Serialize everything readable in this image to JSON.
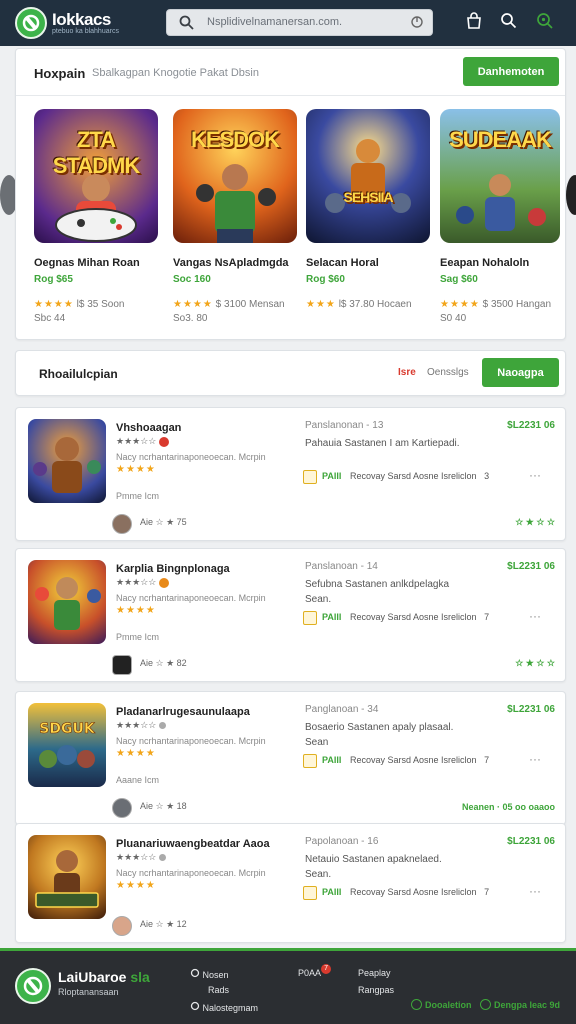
{
  "header": {
    "brand": "Iokkacs",
    "tagline": "ptebuo ka blahhuarcs",
    "search_placeholder": "Nsplidivelnamanersan.com.",
    "icons": [
      "cart-icon",
      "search-icon",
      "discover-icon"
    ]
  },
  "featured": {
    "title": "Hoxpain",
    "subtitle": "Sbalkagpan Knogotie Pakat Dbsin",
    "button": "Danhemoten",
    "games": [
      {
        "art": "ZTA STADMK",
        "name": "Oegnas Mihan Roan",
        "price": "Rog $65",
        "stars": "★★★★",
        "rating": "l$ 35 Soon",
        "sub": "Sbc 44",
        "bg": "#5b2a8c"
      },
      {
        "art": "KESDOK",
        "name": "Vangas NsApladmgda",
        "price": "Soc 160",
        "stars": "★★★★",
        "rating": "$ 3100 Mensan",
        "sub": "So3. 80",
        "bg": "#d8641c"
      },
      {
        "art": "SEHSIIA",
        "name": "Selacan Horal",
        "price": "Rog $60",
        "stars": "★★★",
        "rating": "l$ 37.80 Hocaen",
        "sub": "",
        "bg": "#1c2f6e"
      },
      {
        "art": "SUDEAAK",
        "name": "Eeapan Nohaloln",
        "price": "Sag $60",
        "stars": "★★★★",
        "rating": "$ 3500 Hangan",
        "sub": "S0 40",
        "bg": "#4a8a3c"
      }
    ]
  },
  "recommend": {
    "title": "Rhoailulcpian",
    "filter_tag": "Isre",
    "filter": "Oensslgs",
    "button": "Naoagpa"
  },
  "rows": [
    {
      "name": "Vhshoaagan",
      "badge": "★★★☆☆",
      "desc": "Nacy ncrhantarinaponeoecan. Mcrpin",
      "stars": "★★★★",
      "dev": "Pmme Icm",
      "meta": "Aie ☆ ★ 75",
      "rel": "Panslanonan - 13",
      "price": "$L2231 06",
      "line1": "Pahauia Sastanen I am Kartiepadi.",
      "line2": "",
      "tag": "PAIII",
      "tagtext": "Recovay Sarsd Aosne Isreliclon",
      "tagnum": "3",
      "footer": "☆ ★ ☆ ☆",
      "bg": "#3a4aa0"
    },
    {
      "name": "Karplia Bingnplonaga",
      "badge": "★★★☆☆",
      "desc": "Nacy ncrhantarinaponeoecan. Mcrpin",
      "stars": "★★★★",
      "dev": "Pmme Icm",
      "meta": "Aie ☆ ★ 82",
      "rel": "Panslanoan - 14",
      "price": "$L2231 06",
      "line1": "Sefubna Sastanen anlkdpelagka",
      "line2": "Sean.",
      "tag": "PAIII",
      "tagtext": "Recovay Sarsd Aosne Isreliclon",
      "tagnum": "7",
      "footer": "☆ ★ ☆ ☆",
      "bg": "#c8502a"
    },
    {
      "name": "Pladanarlrugesaunulaapa",
      "badge": "★★★☆☆",
      "desc": "Nacy ncrhantarinaponeoecan. Mcrpin",
      "stars": "★★★★",
      "dev": "Aaane Icm",
      "meta": "Aie ☆ ★ 18",
      "rel": "Panglanoan - 34",
      "price": "$L2231 06",
      "line1": "Bosaerio Sastanen apaly plasaal.",
      "line2": "Sean",
      "tag": "PAIII",
      "tagtext": "Recovay Sarsd Aosne Isreliclon",
      "tagnum": "7",
      "footer": "Neanen · 05 oo oaaoo",
      "bg": "#2d6a8a"
    },
    {
      "name": "Pluanariuwaengbeatdar Aaoa",
      "badge": "★★★☆☆",
      "desc": "Nacy ncrhantarinaponeoecan. Mcrpin",
      "stars": "★★★★",
      "dev": "",
      "meta": "Aie ☆ ★ 12",
      "rel": "Papolanoan - 16",
      "price": "$L2231 06",
      "line1": "Netauio Sastanen apaknelaed.",
      "line2": "Sean.",
      "tag": "PAIII",
      "tagtext": "Recovay Sarsd Aosne Isreliclon",
      "tagnum": "7",
      "footer": "",
      "bg": "#c07820"
    }
  ],
  "footer": {
    "brand": "LaiUbaroe",
    "brand_accent": "sla",
    "sub": "Rloptanansaan",
    "links": [
      "Nosen",
      "Rads",
      "Nalostegmam"
    ],
    "notif_label": "P0AA",
    "notif_count": "7",
    "links2": [
      "Peaplay",
      "Rangpas"
    ],
    "pill1": "Dooaletion",
    "pill2": "Dengpa Ieac 9d"
  }
}
